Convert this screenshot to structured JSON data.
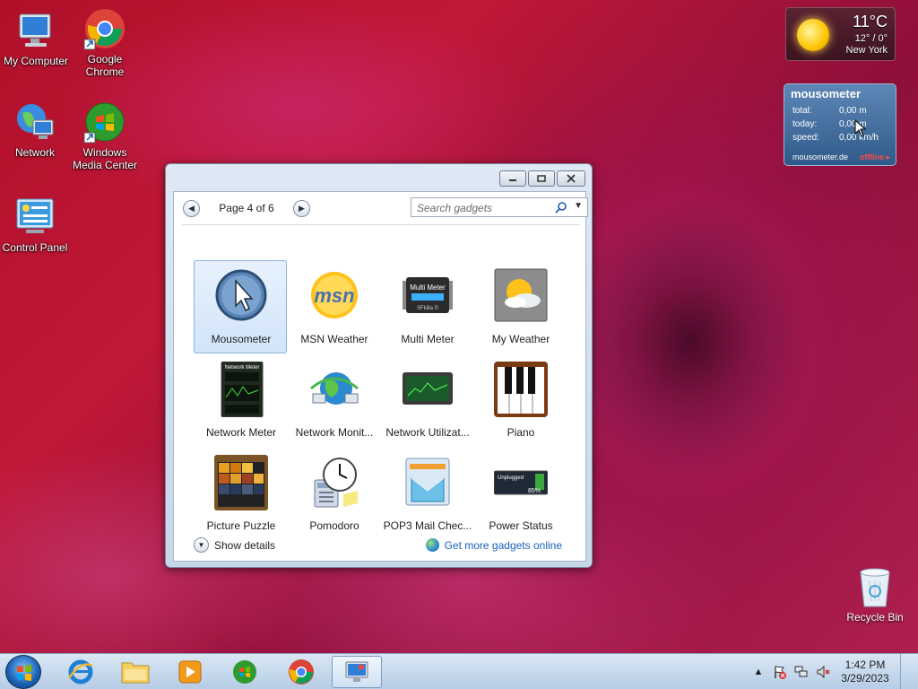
{
  "desktop": {
    "icons": [
      {
        "label": "My Computer"
      },
      {
        "label": "Google Chrome"
      },
      {
        "label": "Network"
      },
      {
        "label": "Windows Media Center"
      },
      {
        "label": "Control Panel"
      },
      {
        "label": "Recycle Bin"
      }
    ]
  },
  "weather_gadget": {
    "temperature": "11°C",
    "range": "12° / 0°",
    "city": "New York",
    "icon": "sun-icon"
  },
  "mousometer_gadget": {
    "title": "mousometer",
    "rows": [
      {
        "label": "total:",
        "value": "0,00 m"
      },
      {
        "label": "today:",
        "value": "0,00 m"
      },
      {
        "label": "speed:",
        "value": "0,00 km/h"
      }
    ],
    "site": "mousometer.de",
    "status": "offline ▸"
  },
  "gadget_window": {
    "page_label": "Page 4 of 6",
    "search_placeholder": "Search gadgets",
    "gadgets": [
      {
        "label": "Mousometer",
        "selected": true
      },
      {
        "label": "MSN Weather"
      },
      {
        "label": "Multi Meter"
      },
      {
        "label": "My Weather"
      },
      {
        "label": "Network Meter"
      },
      {
        "label": "Network Monit..."
      },
      {
        "label": "Network Utilizat..."
      },
      {
        "label": "Piano"
      },
      {
        "label": "Picture Puzzle"
      },
      {
        "label": "Pomodoro"
      },
      {
        "label": "POP3 Mail Chec..."
      },
      {
        "label": "Power Status"
      }
    ],
    "show_details": "Show details",
    "get_more": "Get more gadgets online"
  },
  "taskbar": {
    "time": "1:42 PM",
    "date": "3/29/2023"
  },
  "colors": {
    "accent_link": "#1760b8",
    "selection_border": "#89b2e0",
    "offline_red": "#ff4a4a"
  }
}
